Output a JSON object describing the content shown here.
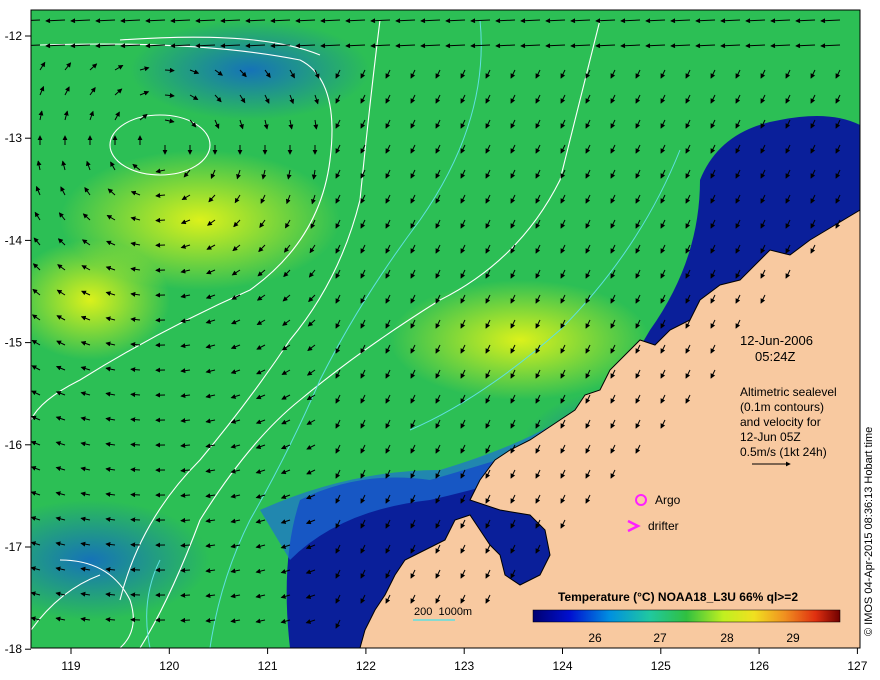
{
  "map": {
    "lon_ticks": [
      "119",
      "120",
      "121",
      "122",
      "123",
      "124",
      "125",
      "126",
      "127"
    ],
    "lat_ticks": [
      "-12",
      "-13",
      "-14",
      "-15",
      "-16",
      "-17",
      "-18"
    ],
    "colors": {
      "land": "#f8c9a0",
      "sea_cool": "#12229a",
      "sea_mid": "#18b85a",
      "sea_warm": "#d8f020",
      "contour": "#ffffff",
      "bathymetry": "#60e0e0",
      "marker": "#ff20ff"
    }
  },
  "annotations": {
    "date": "12-Jun-2006",
    "time": "05:24Z",
    "description": [
      "Altimetric sealevel",
      "(0.1m contours)",
      "and velocity for",
      "12-Jun 05Z",
      "0.5m/s (1kt 24h)"
    ],
    "argo_label": "Argo",
    "drifter_label": "drifter",
    "bathymetry_label": "200  1000m"
  },
  "colorbar": {
    "title": "Temperature (°C) NOAA18_L3U 66% ql>=2",
    "ticks": [
      "26",
      "27",
      "28",
      "29"
    ]
  },
  "credit": "© IMOS 04-Apr-2015 08:36:13 Hobart time"
}
